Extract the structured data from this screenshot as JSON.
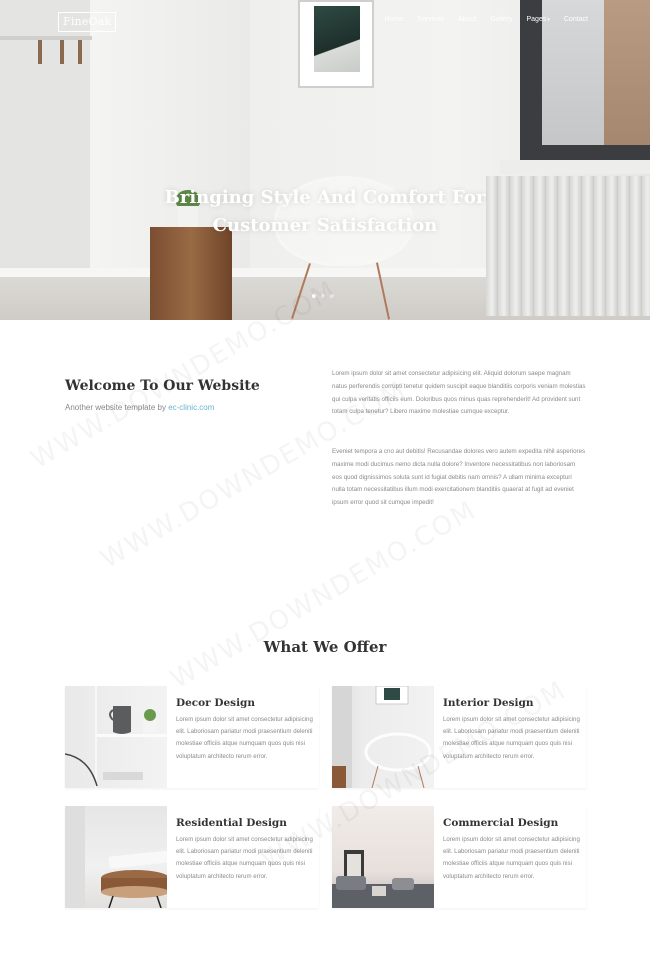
{
  "brand": {
    "logo_text": "FineOak"
  },
  "nav": {
    "items": [
      {
        "label": "Home"
      },
      {
        "label": "Services"
      },
      {
        "label": "About"
      },
      {
        "label": "Gallery"
      },
      {
        "label": "Pages"
      },
      {
        "label": "Contact"
      }
    ]
  },
  "hero": {
    "title_line1": "Bringing Style And Comfort For",
    "title_line2": "Customer Satisfaction",
    "active_slide": 1,
    "slide_count": 3
  },
  "welcome": {
    "title": "Welcome To Our Website",
    "subtitle_prefix": "Another website template by",
    "subtitle_link": "ec-clinic.com",
    "paragraph1": "Lorem ipsum dolor sit amet consectetur adipisicing elit. Aliquid dolorum saepe magnam natus perferendis corrupti tenetur quidem suscipit eaque blanditiis corporis veniam molestias qui culpa veritatis officiis eum. Doloribus quos minus quas reprehenderit! Ad provident sunt totam culpa tenetur? Libero maxime molestiae cumque exceptur.",
    "paragraph2": "Eveniet tempora a cno aut debitis! Recusandae dolores vero autem expedita nihil asperiores maxime modi ducimus nemo dicta nulla dolore? Inventore necessitatibus non laboriosam eos quod dignissimos soluta sunt id fugiat debitis nam omnis? A ullam minima excepturi nulla totam necessitatibus illum modi exercitationem blanditiis quaerat at fugit ad eveniet ipsum error quod sit cumque impedit!"
  },
  "offer": {
    "title": "What We Offer",
    "cards": [
      {
        "title": "Decor Design",
        "text": "Lorem ipsum dolor sit amet consectetur adipisicing elit. Laboriosam pariatur modi praesentium deleniti molestiae officiis atque numquam quos quis nisi voluptatum architecto rerum error."
      },
      {
        "title": "Interior Design",
        "text": "Lorem ipsum dolor sit amet consectetur adipisicing elit. Laboriosam pariatur modi praesentium deleniti molestiae officiis atque numquam quos quis nisi voluptatum architecto rerum error."
      },
      {
        "title": "Residential Design",
        "text": "Lorem ipsum dolor sit amet consectetur adipisicing elit. Laboriosam pariatur modi praesentium deleniti molestiae officiis atque numquam quos quis nisi voluptatum architecto rerum error."
      },
      {
        "title": "Commercial Design",
        "text": "Lorem ipsum dolor sit amet consectetur adipisicing elit. Laboriosam pariatur modi praesentium deleniti molestiae officiis atque numquam quos quis nisi voluptatum architecto rerum error."
      }
    ]
  },
  "watermark": {
    "text": "WWW.DOWNDEMO.COM"
  },
  "colors": {
    "link": "#69b4cf",
    "heading": "#333333",
    "body_text": "#8a8a8a"
  },
  "icons": {
    "pages_dropdown": "caret-down-icon"
  }
}
